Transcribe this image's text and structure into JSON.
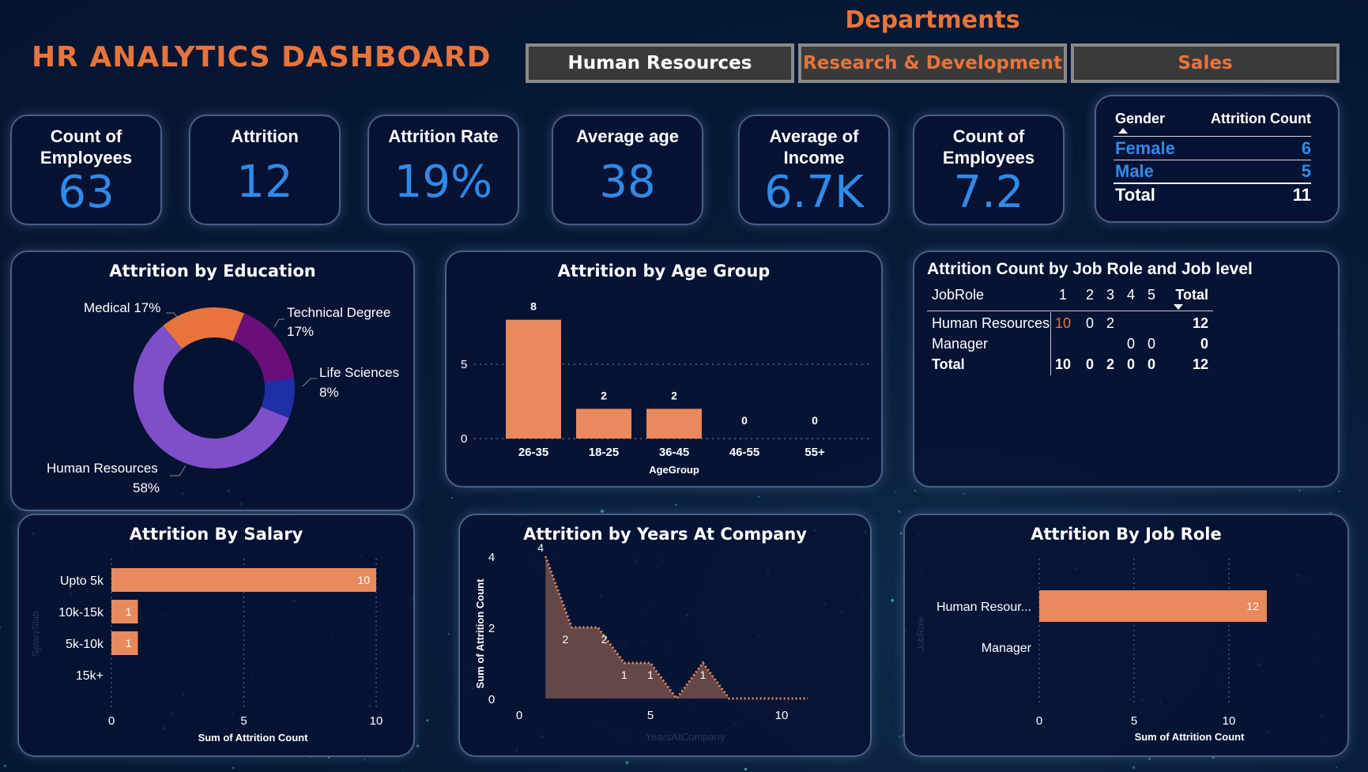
{
  "header": {
    "title": "HR ANALYTICS DASHBOARD",
    "departments_title": "Departments",
    "departments": [
      {
        "label": "Human Resources",
        "state": "selected"
      },
      {
        "label": "Research & Development",
        "state": "unselected"
      },
      {
        "label": "Sales",
        "state": "unselected"
      }
    ]
  },
  "kpis": [
    {
      "label": "Count of Employees",
      "value": "63"
    },
    {
      "label": "Attrition",
      "value": "12"
    },
    {
      "label": "Attrition Rate",
      "value": "19%"
    },
    {
      "label": "Average age",
      "value": "38"
    },
    {
      "label": "Average of Income",
      "value": "6.7K"
    },
    {
      "label": "Count of Employees",
      "value": "7.2"
    }
  ],
  "gender_table": {
    "headers": [
      "Gender",
      "Attrition Count"
    ],
    "rows": [
      {
        "label": "Female",
        "value": "6"
      },
      {
        "label": "Male",
        "value": "5"
      }
    ],
    "total": {
      "label": "Total",
      "value": "11"
    }
  },
  "education": {
    "title": "Attrition by Education",
    "slices": [
      {
        "name": "Human Resources",
        "pct": 58,
        "label": "58%",
        "color": "#7e4fc9"
      },
      {
        "name": "Medical",
        "pct": 17,
        "label": "17%",
        "color": "#e8743b"
      },
      {
        "name": "Technical Degree",
        "pct": 17,
        "label": "17%",
        "color": "#6a0f7a"
      },
      {
        "name": "Life Sciences",
        "pct": 8,
        "label": "8%",
        "color": "#1f2fa6"
      }
    ]
  },
  "age_group": {
    "title": "Attrition by Age Group",
    "xlabel": "AgeGroup",
    "categories": [
      "26-35",
      "18-25",
      "36-45",
      "46-55",
      "55+"
    ],
    "values": [
      8,
      2,
      2,
      0,
      0
    ],
    "yticks": [
      "0",
      "5"
    ],
    "ymax": 8
  },
  "jobrole_matrix": {
    "title": "Attrition Count by Job Role and Job level",
    "headers": [
      "JobRole",
      "1",
      "2",
      "3",
      "4",
      "5",
      "Total"
    ],
    "rows": [
      [
        "Human Resources",
        "10",
        "0",
        "2",
        "",
        "",
        "12"
      ],
      [
        "Manager",
        "",
        "",
        "",
        "0",
        "0",
        "0"
      ]
    ],
    "total": [
      "Total",
      "10",
      "0",
      "2",
      "0",
      "0",
      "12"
    ]
  },
  "salary": {
    "title": "Attrition By Salary",
    "axis_title": "SalarySlab",
    "xlabel": "Sum of Attrition Count",
    "categories": [
      "Upto 5k",
      "10k-15k",
      "5k-10k",
      "15k+"
    ],
    "values": [
      10,
      1,
      1,
      0
    ],
    "xticks": [
      "0",
      "5",
      "10"
    ],
    "xmax": 10
  },
  "years": {
    "title": "Attrition by Years At Company",
    "ylabel": "Sum of Attrition Count",
    "xlabel": "YearsAtCompany",
    "xticks": [
      "0",
      "5",
      "10"
    ],
    "yticks": [
      "0",
      "2",
      "4"
    ]
  },
  "jobrole_bar": {
    "title": "Attrition By Job Role",
    "axis_title": "JobRole",
    "xlabel": "Sum of Attrition Count",
    "categories": [
      "Human Resour...",
      "Manager"
    ],
    "values": [
      12,
      0
    ],
    "xticks": [
      "0",
      "5",
      "10"
    ],
    "xmax": 12
  },
  "chart_data": [
    {
      "type": "pie",
      "title": "Attrition by Education",
      "categories": [
        "Human Resources",
        "Medical",
        "Technical Degree",
        "Life Sciences"
      ],
      "values": [
        58,
        17,
        17,
        8
      ]
    },
    {
      "type": "bar",
      "title": "Attrition by Age Group",
      "categories": [
        "26-35",
        "18-25",
        "36-45",
        "46-55",
        "55+"
      ],
      "values": [
        8,
        2,
        2,
        0,
        0
      ],
      "xlabel": "AgeGroup",
      "ylabel": ""
    },
    {
      "type": "bar",
      "title": "Attrition By Salary",
      "categories": [
        "Upto 5k",
        "10k-15k",
        "5k-10k",
        "15k+"
      ],
      "values": [
        10,
        1,
        1,
        0
      ],
      "xlabel": "Sum of Attrition Count",
      "ylabel": "SalarySlab",
      "xlim": [
        0,
        10
      ]
    },
    {
      "type": "area",
      "title": "Attrition by Years At Company",
      "x": [
        1,
        2,
        3,
        4,
        5,
        6,
        7,
        8,
        9,
        10,
        11
      ],
      "values": [
        4,
        2,
        2,
        1,
        1,
        0,
        1,
        0,
        0,
        0,
        0
      ],
      "xlabel": "YearsAtCompany",
      "ylabel": "Sum of Attrition Count",
      "ylim": [
        0,
        4
      ]
    },
    {
      "type": "bar",
      "title": "Attrition By Job Role",
      "categories": [
        "Human Resour...",
        "Manager"
      ],
      "values": [
        12,
        0
      ],
      "xlabel": "Sum of Attrition Count",
      "ylabel": "JobRole"
    }
  ]
}
